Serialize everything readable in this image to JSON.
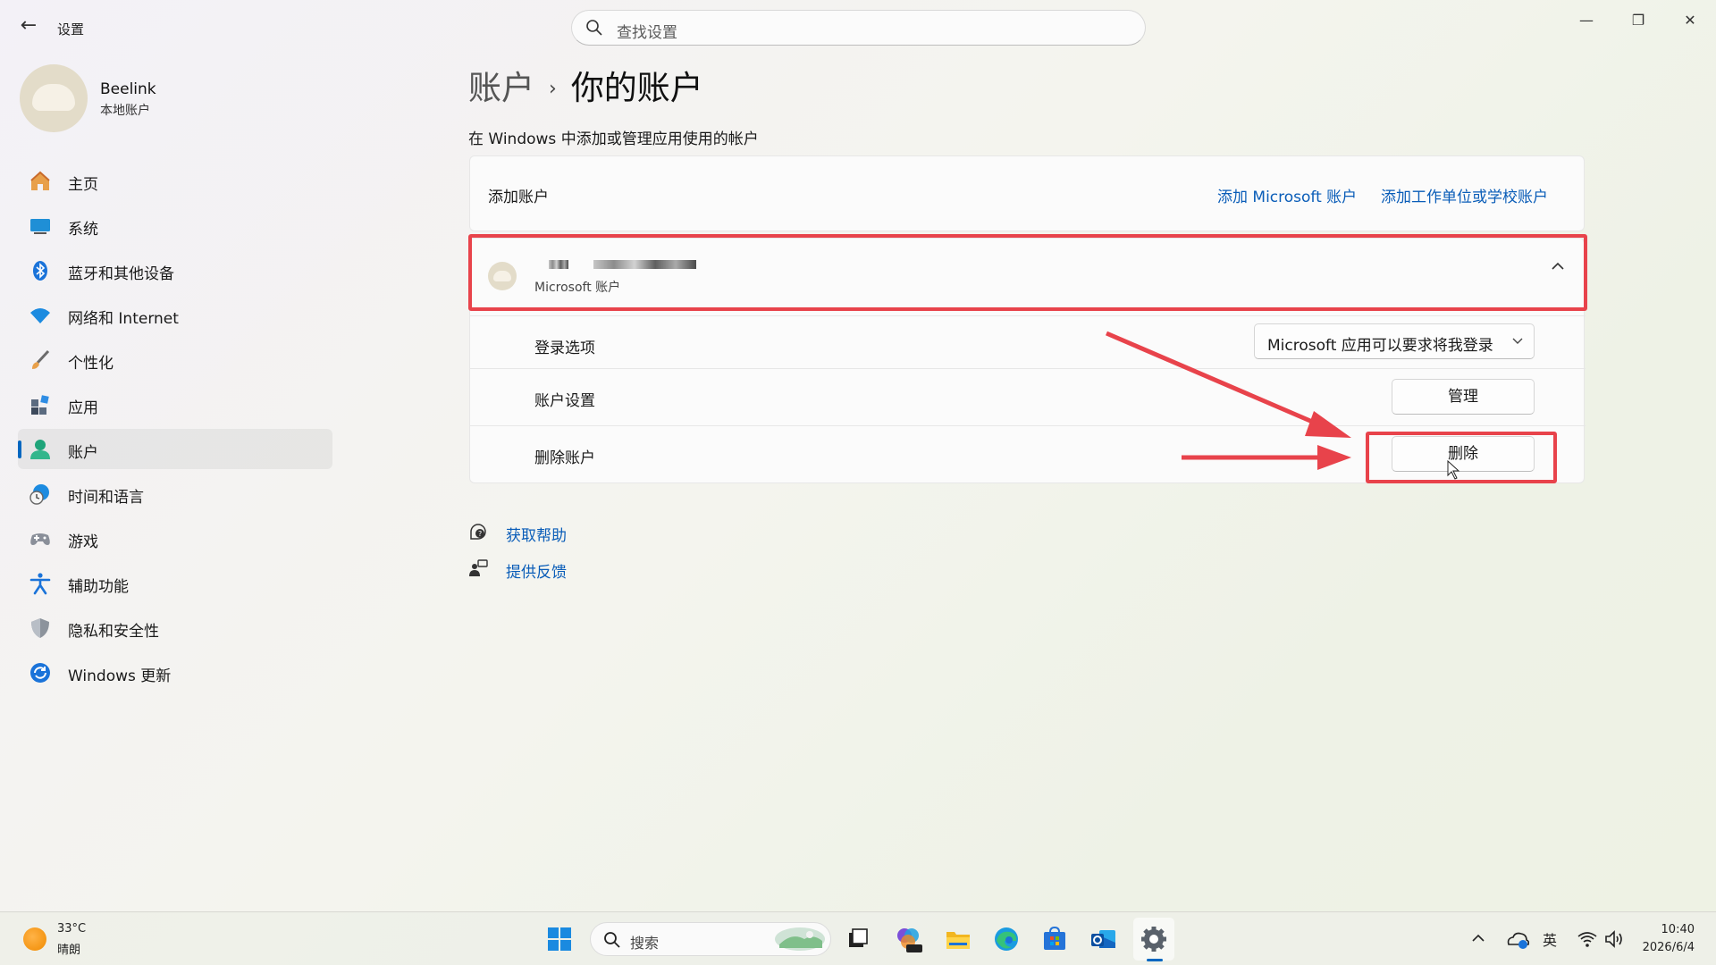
{
  "window": {
    "app_title": "设置",
    "search_placeholder": "查找设置",
    "back_glyph": "←",
    "minimize_glyph": "—",
    "restore_glyph": "❐",
    "close_glyph": "✕"
  },
  "profile": {
    "name": "Beelink",
    "type": "本地账户"
  },
  "sidebar": {
    "items": [
      {
        "label": "主页",
        "icon": "home-icon"
      },
      {
        "label": "系统",
        "icon": "system-icon"
      },
      {
        "label": "蓝牙和其他设备",
        "icon": "bluetooth-icon"
      },
      {
        "label": "网络和 Internet",
        "icon": "wifi-icon"
      },
      {
        "label": "个性化",
        "icon": "brush-icon"
      },
      {
        "label": "应用",
        "icon": "apps-icon"
      },
      {
        "label": "账户",
        "icon": "account-icon",
        "active": true
      },
      {
        "label": "时间和语言",
        "icon": "clock-globe-icon"
      },
      {
        "label": "游戏",
        "icon": "gamepad-icon"
      },
      {
        "label": "辅助功能",
        "icon": "accessibility-icon"
      },
      {
        "label": "隐私和安全性",
        "icon": "shield-icon"
      },
      {
        "label": "Windows 更新",
        "icon": "update-icon"
      }
    ]
  },
  "main": {
    "breadcrumb_parent": "账户",
    "breadcrumb_sep": "›",
    "breadcrumb_current": "你的账户",
    "subtitle": "在 Windows 中添加或管理应用使用的帐户",
    "add_account": {
      "label": "添加账户",
      "link_microsoft": "添加 Microsoft 账户",
      "link_work": "添加工作单位或学校账户"
    },
    "account": {
      "type": "Microsoft 账户",
      "chevron": "^",
      "rows": {
        "signin_label": "登录选项",
        "signin_value": "Microsoft 应用可以要求将我登录",
        "settings_label": "账户设置",
        "manage_button": "管理",
        "remove_label": "删除账户",
        "remove_button": "删除"
      }
    },
    "help": {
      "get_help": "获取帮助",
      "feedback": "提供反馈"
    }
  },
  "annotations": {
    "highlight_color": "#e8434b",
    "arrow_color": "#e8434b"
  },
  "taskbar": {
    "temperature": "33°C",
    "condition": "晴朗",
    "search_placeholder": "搜索",
    "ime": "英",
    "tray_chevron": "^",
    "time": "10:40",
    "date": "2026/6/4"
  }
}
